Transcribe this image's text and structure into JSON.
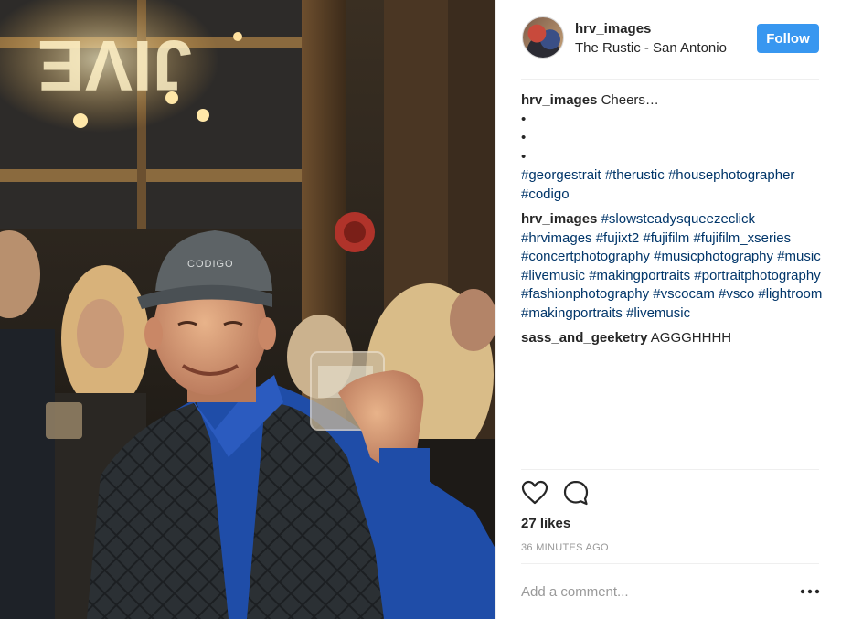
{
  "post": {
    "username": "hrv_images",
    "location": "The Rustic - San Antonio",
    "follow_label": "Follow",
    "photo_alt": "Man in a gray cap raising a glass at a party",
    "cap_text": "CODIGO"
  },
  "comments": [
    {
      "user": "hrv_images",
      "text": "Cheers…",
      "bullets": [
        "•",
        "•",
        "•"
      ],
      "tags": [
        "#georgestrait",
        "#therustic",
        "#housephotographer",
        "#codigo"
      ]
    },
    {
      "user": "hrv_images",
      "tags": [
        "#slowsteadysqueezeclick",
        "#hrvimages",
        "#fujixt2",
        "#fujifilm",
        "#fujifilm_xseries",
        "#concertphotography",
        "#musicphotography",
        "#music",
        "#livemusic",
        "#makingportraits",
        "#portraitphotography",
        "#fashionphotography",
        "#vscocam",
        "#vsco",
        "#lightroom",
        "#makingportraits",
        "#livemusic"
      ]
    },
    {
      "user": "sass_and_geeketry",
      "text": "AGGGHHHH"
    }
  ],
  "engagement": {
    "likes_label": "27 likes",
    "time_label": "36 MINUTES AGO"
  },
  "comment_box": {
    "placeholder": "Add a comment..."
  },
  "icons": {
    "like": "heart-icon",
    "comment": "comment-bubble-icon",
    "more": "more-options-icon"
  },
  "colors": {
    "follow_button": "#3897f0",
    "hashtag": "#003569",
    "muted": "#999999",
    "text": "#262626"
  }
}
